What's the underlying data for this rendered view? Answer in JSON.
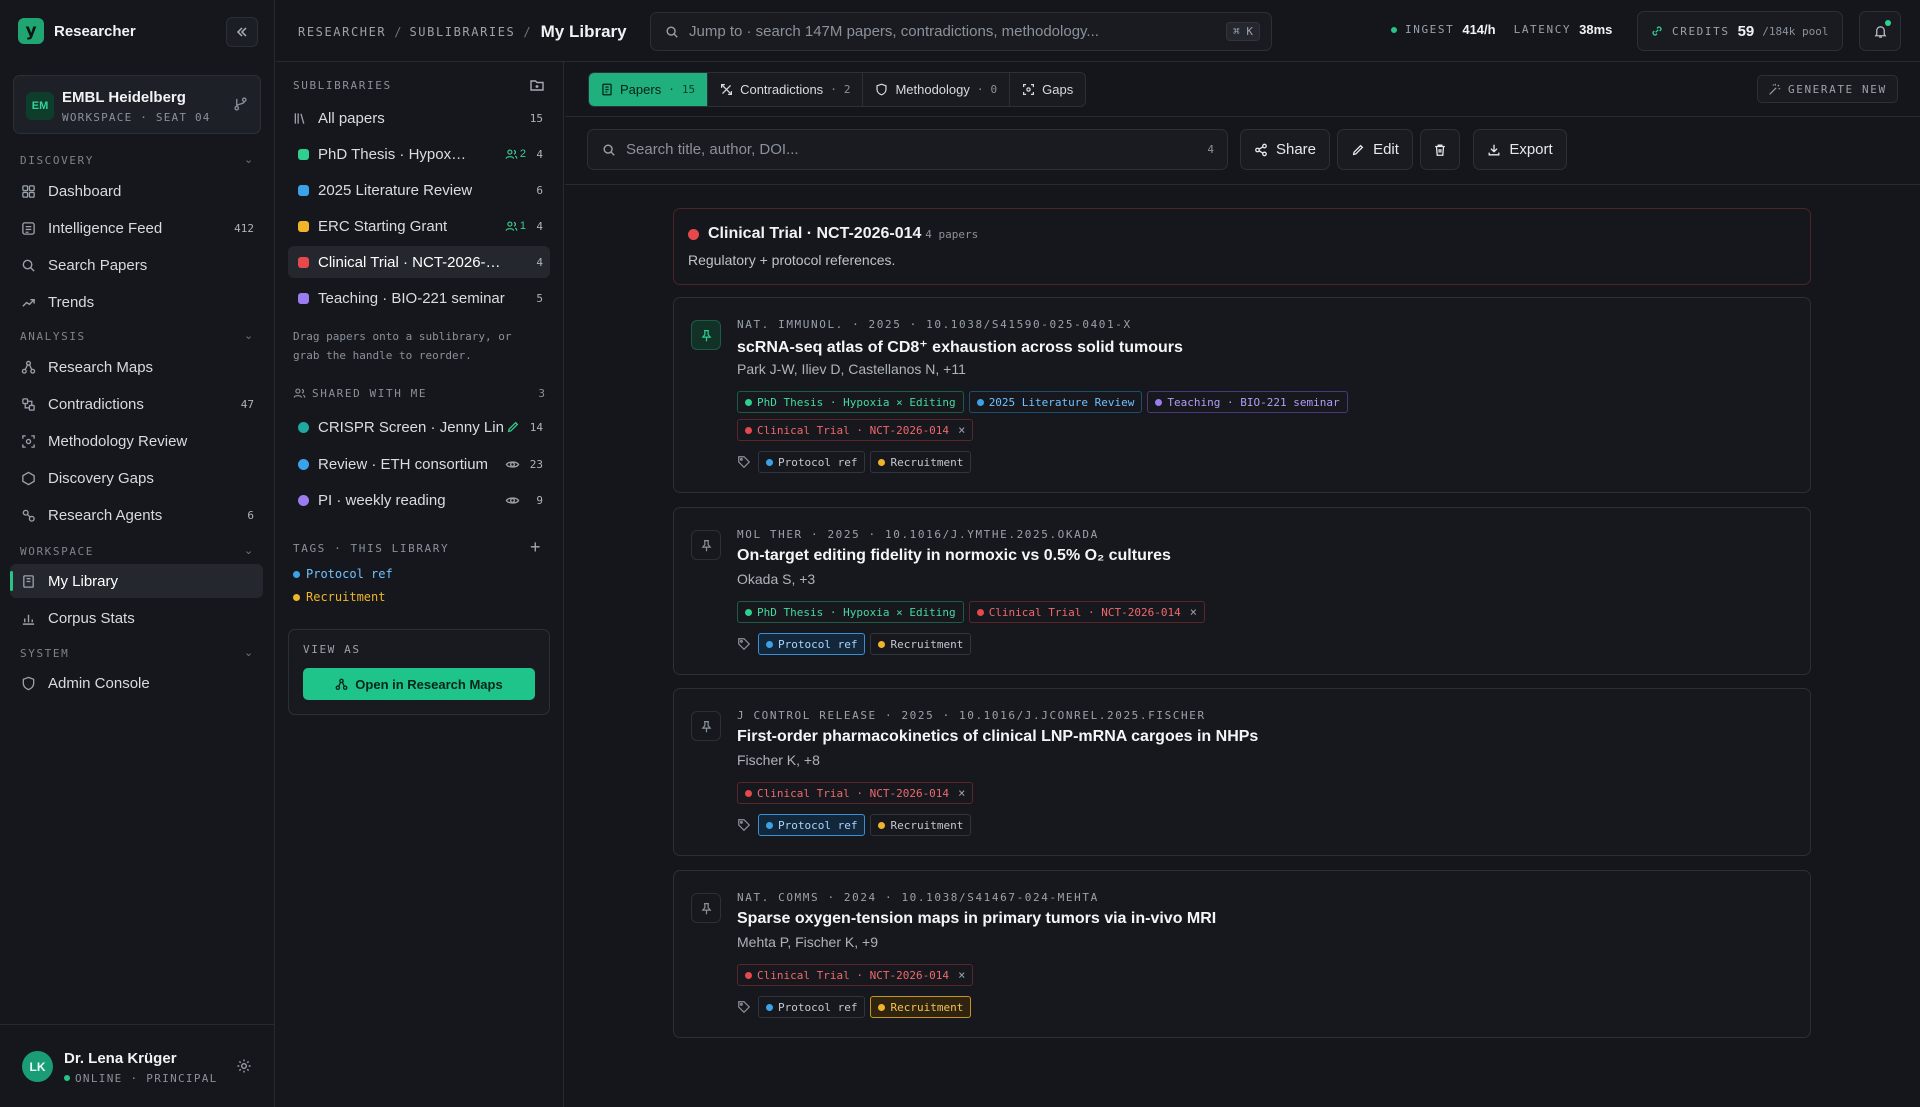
{
  "app": {
    "name": "Researcher",
    "logo_letter": "y"
  },
  "colors": {
    "accent": "#1fb07d",
    "red": "#e5484d",
    "blue": "#3aa3e8",
    "yellow": "#f0b429",
    "purple": "#9b7cf0",
    "teal": "#1fa7a0",
    "green": "#2ecf8f"
  },
  "workspace": {
    "initials": "EM",
    "name": "EMBL Heidelberg",
    "sub": "WORKSPACE · SEAT 04"
  },
  "sidebar": {
    "sections": [
      {
        "label": "DISCOVERY"
      },
      {
        "label": "ANALYSIS"
      },
      {
        "label": "WORKSPACE"
      },
      {
        "label": "SYSTEM"
      }
    ],
    "items": [
      {
        "label": "Dashboard",
        "icon": "grid-icon",
        "count": ""
      },
      {
        "label": "Intelligence Feed",
        "icon": "feed-icon",
        "count": "412"
      },
      {
        "label": "Search Papers",
        "icon": "search-icon",
        "count": ""
      },
      {
        "label": "Trends",
        "icon": "trend-icon",
        "count": ""
      },
      {
        "label": "Research Maps",
        "icon": "map-icon",
        "count": ""
      },
      {
        "label": "Contradictions",
        "icon": "contradiction-icon",
        "count": "47"
      },
      {
        "label": "Methodology Review",
        "icon": "scan-icon",
        "count": ""
      },
      {
        "label": "Discovery Gaps",
        "icon": "hexagon-icon",
        "count": ""
      },
      {
        "label": "Research Agents",
        "icon": "agent-icon",
        "count": "6"
      },
      {
        "label": "My Library",
        "icon": "library-icon",
        "count": ""
      },
      {
        "label": "Corpus Stats",
        "icon": "bar-chart-icon",
        "count": ""
      },
      {
        "label": "Admin Console",
        "icon": "shield-icon",
        "count": ""
      }
    ]
  },
  "user": {
    "initials": "LK",
    "name": "Dr. Lena Krüger",
    "status": "ONLINE · PRINCIPAL"
  },
  "topbar": {
    "crumbs": [
      "RESEARCHER",
      "SUBLIBRARIES"
    ],
    "crumb_sep": "/",
    "current": "My Library",
    "search_placeholder": "Jump to · search 147M papers, contradictions, methodology...",
    "shortcut": "⌘ K",
    "ingest_label": "INGEST",
    "ingest_value": "414/h",
    "latency_label": "LATENCY",
    "latency_value": "38ms",
    "credits_label": "CREDITS",
    "credits_value": "59",
    "credits_pool": "/184k pool"
  },
  "sublibraries": {
    "heading": "SUBLIBRARIES",
    "all": {
      "label": "All papers",
      "count": "15"
    },
    "items": [
      {
        "label": "PhD Thesis · Hypoxia × Editing",
        "collab": "2",
        "count": "4",
        "color": "#2ecf8f"
      },
      {
        "label": "2025 Literature Review",
        "collab": "",
        "count": "6",
        "color": "#3aa3e8"
      },
      {
        "label": "ERC Starting Grant",
        "collab": "1",
        "count": "4",
        "color": "#f0b429"
      },
      {
        "label": "Clinical Trial · NCT-2026-014",
        "collab": "",
        "count": "4",
        "color": "#e5484d"
      },
      {
        "label": "Teaching · BIO-221 seminar",
        "collab": "",
        "count": "5",
        "color": "#9b7cf0"
      }
    ],
    "hint": "Drag papers onto a sublibrary, or grab the handle to reorder.",
    "shared_heading": "SHARED WITH ME",
    "shared_count": "3",
    "shared": [
      {
        "label": "CRISPR Screen · Jenny Lin",
        "perm": "edit",
        "count": "14",
        "color": "#1fa7a0"
      },
      {
        "label": "Review · ETH consortium",
        "perm": "view",
        "count": "23",
        "color": "#3aa3e8"
      },
      {
        "label": "PI · weekly reading",
        "perm": "view",
        "count": "9",
        "color": "#9b7cf0"
      }
    ],
    "tags_heading": "TAGS · THIS LIBRARY",
    "tags": [
      {
        "label": "Protocol ref",
        "color": "#3aa3e8",
        "text_color": "#6fc2ff"
      },
      {
        "label": "Recruitment",
        "color": "#f0b429",
        "text_color": "#f0b429"
      }
    ],
    "view_as_label": "VIEW AS",
    "view_as_button": "Open in Research Maps"
  },
  "main": {
    "tabs": [
      {
        "label": "Papers",
        "count": "15",
        "icon": "document-icon"
      },
      {
        "label": "Contradictions",
        "count": "2",
        "icon": "contradiction-icon"
      },
      {
        "label": "Methodology",
        "count": "0",
        "icon": "shield-icon"
      },
      {
        "label": "Gaps",
        "count": "",
        "icon": "scan-icon"
      }
    ],
    "generate_label": "GENERATE NEW",
    "search_placeholder": "Search title, author, DOI...",
    "search_count": "4",
    "share_label": "Share",
    "edit_label": "Edit",
    "export_label": "Export",
    "library": {
      "title": "Clinical Trial · NCT-2026-014",
      "count": "4 papers",
      "description": "Regulatory + protocol references."
    },
    "papers": [
      {
        "meta": "NAT. IMMUNOL. · 2025 · 10.1038/S41590-025-0401-X",
        "title": "scRNA-seq atlas of CD8⁺ exhaustion across solid tumours",
        "authors": "Park J-W, Iliev D, Castellanos N, +11",
        "sublibs": [
          "PhD Thesis · Hypoxia × Editing",
          "2025 Literature Review",
          "Teaching · BIO-221 seminar",
          "Clinical Trial · NCT-2026-014"
        ],
        "tags": [
          "Protocol ref",
          "Recruitment"
        ]
      },
      {
        "meta": "MOL THER · 2025 · 10.1016/J.YMTHE.2025.OKADA",
        "title": "On-target editing fidelity in normoxic vs 0.5% O₂ cultures",
        "authors": "Okada S, +3",
        "sublibs": [
          "PhD Thesis · Hypoxia × Editing",
          "Clinical Trial · NCT-2026-014"
        ],
        "tags": [
          "Protocol ref",
          "Recruitment"
        ]
      },
      {
        "meta": "J CONTROL RELEASE · 2025 · 10.1016/J.JCONREL.2025.FISCHER",
        "title": "First-order pharmacokinetics of clinical LNP-mRNA cargoes in NHPs",
        "authors": "Fischer K, +8",
        "sublibs": [
          "Clinical Trial · NCT-2026-014"
        ],
        "tags": [
          "Protocol ref",
          "Recruitment"
        ]
      },
      {
        "meta": "NAT. COMMS · 2024 · 10.1038/S41467-024-MEHTA",
        "title": "Sparse oxygen-tension maps in primary tumors via in-vivo MRI",
        "authors": "Mehta P, Fischer K, +9",
        "sublibs": [
          "Clinical Trial · NCT-2026-014"
        ],
        "tags": [
          "Protocol ref",
          "Recruitment"
        ]
      }
    ]
  }
}
